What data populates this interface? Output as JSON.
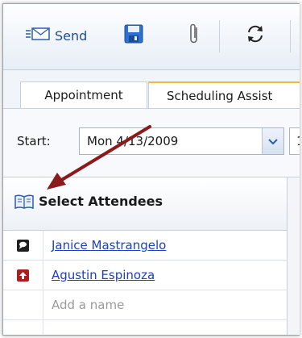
{
  "toolbar": {
    "send_label": "Send",
    "icons": [
      "send-envelope-icon",
      "save-disk-icon",
      "attach-paperclip-icon",
      "refresh-icon"
    ]
  },
  "tabs": [
    {
      "label": "Appointment",
      "active": false
    },
    {
      "label": "Scheduling Assist",
      "active": true
    }
  ],
  "start": {
    "label": "Start:",
    "date_value": "Mon 4/13/2009",
    "time_value": "1"
  },
  "attendees": {
    "header": "Select Attendees",
    "rows": [
      {
        "name": "Janice Mastrangelo",
        "status_icon": "speech-bubble-icon",
        "status_color": "#1f1f1f"
      },
      {
        "name": "Agustin Espinoza",
        "status_icon": "up-arrow-icon",
        "status_color": "#b01c1c"
      }
    ],
    "add_placeholder": "Add a name"
  },
  "colors": {
    "link": "#1f3fbf",
    "accent_tab": "#f0b93a",
    "annotation_arrow": "#8b1a1a"
  }
}
